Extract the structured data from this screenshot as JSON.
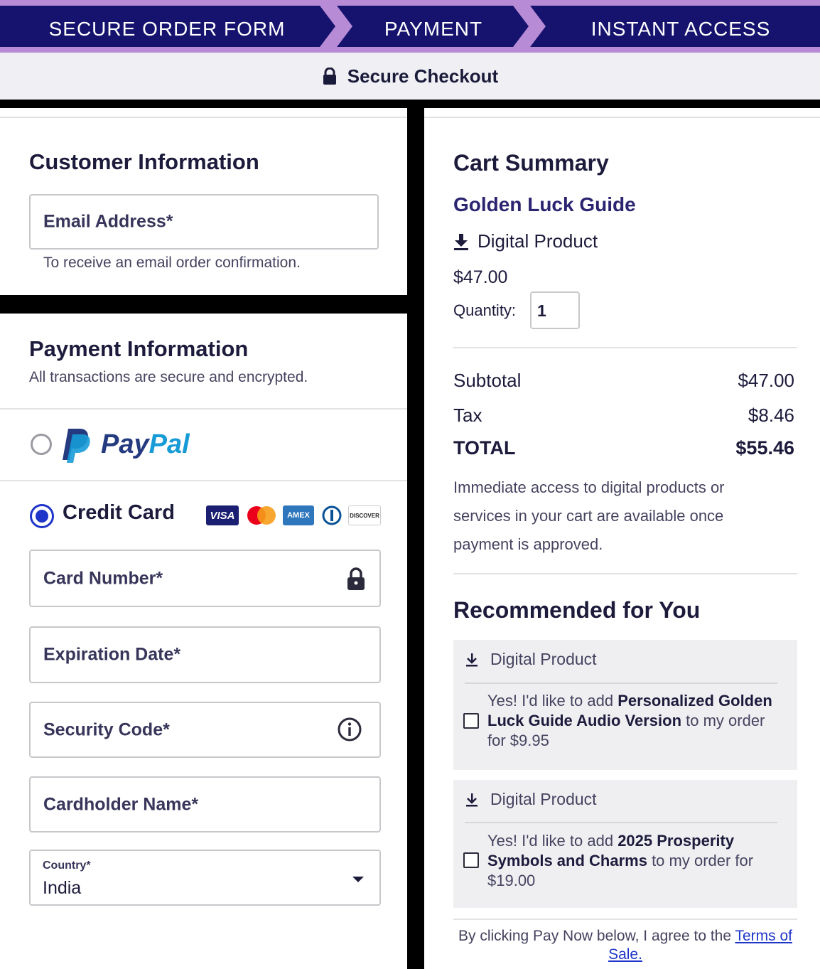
{
  "steps": [
    "SECURE ORDER FORM",
    "PAYMENT",
    "INSTANT ACCESS"
  ],
  "checkout_title": "Secure Checkout",
  "customer": {
    "title": "Customer Information",
    "email_label": "Email Address*",
    "email_help": "To receive an email order confirmation."
  },
  "payment": {
    "title": "Payment Information",
    "subtitle": "All transactions are secure and encrypted.",
    "paypal_label": "PayPal",
    "credit_card_label": "Credit Card",
    "card_brands": [
      "VISA",
      "AMEX",
      "DISCOVER"
    ],
    "card_number_label": "Card Number*",
    "expiration_label": "Expiration Date*",
    "security_code_label": "Security Code*",
    "cardholder_label": "Cardholder Name*",
    "country_label": "Country*",
    "country_value": "India",
    "selected_method": "credit-card"
  },
  "cart": {
    "title": "Cart Summary",
    "product_name": "Golden Luck Guide",
    "product_type": "Digital Product",
    "price": "$47.00",
    "quantity_label": "Quantity:",
    "quantity_value": "1",
    "subtotal_label": "Subtotal",
    "subtotal_value": "$47.00",
    "tax_label": "Tax",
    "tax_value": "$8.46",
    "total_label": "TOTAL",
    "total_value": "$55.46",
    "access_note": "Immediate access to digital products or services in your cart are available once payment is approved."
  },
  "recommended": {
    "title": "Recommended for You",
    "items": [
      {
        "type": "Digital Product",
        "prefix": "Yes! I'd like to add ",
        "name": "Personalized Golden Luck Guide Audio Version",
        "suffix": " to my order for $9.95"
      },
      {
        "type": "Digital Product",
        "prefix": "Yes! I'd like to add ",
        "name": "2025 Prosperity Symbols and Charms",
        "suffix": " to my order for $19.00"
      }
    ]
  },
  "terms": {
    "prefix": "By clicking Pay Now below, I agree to the ",
    "link": "Terms of Sale."
  },
  "colors": {
    "header_navy": "#16136e",
    "header_accent": "#b88bd6",
    "radio_blue": "#1f35c9",
    "paypal_dark": "#253b80",
    "paypal_light": "#179bd7"
  }
}
